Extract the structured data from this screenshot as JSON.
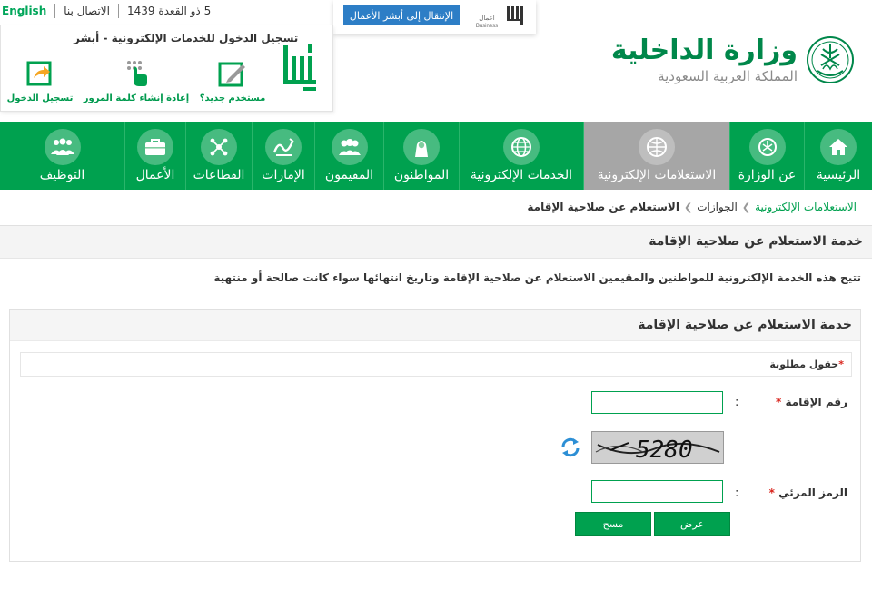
{
  "utility_bar": {
    "date": "5 ذو القعدة 1439",
    "contact": "الاتصال بنا",
    "language": "English"
  },
  "login_panel": {
    "title": "تسجيل الدخول للخدمات الإلكترونية - أبشر",
    "actions": [
      {
        "label": "تسجيل الدخول",
        "icon": "login-arrow-icon"
      },
      {
        "label": "إعادة إنشاء كلمة المرور",
        "icon": "password-reset-icon"
      },
      {
        "label": "مستخدم جديد؟",
        "icon": "new-user-icon"
      }
    ],
    "logo": "absher-logo"
  },
  "business_banner": {
    "button_label": "الإنتقال إلى أبشر الأعمال",
    "logo_text": "اعمال Business"
  },
  "ministry": {
    "name": "وزارة الداخلية",
    "country": "المملكة العربية السعودية"
  },
  "nav": {
    "items": [
      {
        "label": "الرئيسية",
        "icon": "home-icon"
      },
      {
        "label": "عن الوزارة",
        "icon": "emblem-icon"
      },
      {
        "label": "الاستعلامات الإلكترونية",
        "icon": "e-inquiries-icon",
        "active": true
      },
      {
        "label": "الخدمات الإلكترونية",
        "icon": "globe-icon"
      },
      {
        "label": "المواطنون",
        "icon": "citizen-icon"
      },
      {
        "label": "المقيمون",
        "icon": "residents-icon"
      },
      {
        "label": "الإمارات",
        "icon": "emirates-icon"
      },
      {
        "label": "القطاعات",
        "icon": "sectors-icon"
      },
      {
        "label": "الأعمال",
        "icon": "briefcase-icon"
      },
      {
        "label": "التوظيف",
        "icon": "employment-icon"
      }
    ]
  },
  "breadcrumb": {
    "root": "الاستعلامات الإلكترونية",
    "middle": "الجوازات",
    "current": "الاستعلام عن صلاحية الإقامة"
  },
  "page": {
    "title": "خدمة الاستعلام عن صلاحية الإقامة",
    "description": "تتيح هذه الخدمة الإلكترونية للمواطنين والمقيمين الاستعلام عن صلاحية الإقامة وتاريخ انتهائها سواء كانت صالحة أو منتهية"
  },
  "form": {
    "title": "خدمة الاستعلام عن صلاحية الإقامة",
    "required_note": "حقول مطلوبة",
    "iqama_label": "رقم الإقامة",
    "iqama_value": "",
    "captcha_text": "5280",
    "visual_code_label": "الرمز المرئي",
    "visual_code_value": "",
    "colon": ":",
    "star": "*",
    "submit_label": "عرض",
    "clear_label": "مسح"
  },
  "colors": {
    "brand_green": "#00a14f",
    "active_nav": "#a6a6a6",
    "link_blue": "#2d7ec6",
    "required_red": "#d9241c"
  }
}
